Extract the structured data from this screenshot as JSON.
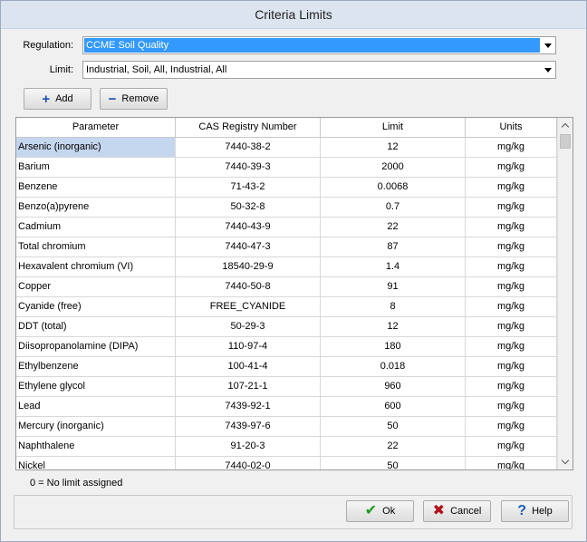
{
  "window": {
    "title": "Criteria Limits"
  },
  "regulation": {
    "label": "Regulation:",
    "value": "CCME Soil Quality"
  },
  "limit": {
    "label": "Limit:",
    "value": "Industrial, Soil, All, Industrial, All"
  },
  "toolbar": {
    "add_label": "Add",
    "remove_label": "Remove"
  },
  "table": {
    "columns": [
      "Parameter",
      "CAS Registry Number",
      "Limit",
      "Units"
    ],
    "rows": [
      [
        "Arsenic (inorganic)",
        "7440-38-2",
        "12",
        "mg/kg"
      ],
      [
        "Barium",
        "7440-39-3",
        "2000",
        "mg/kg"
      ],
      [
        "Benzene",
        "71-43-2",
        "0.0068",
        "mg/kg"
      ],
      [
        "Benzo(a)pyrene",
        "50-32-8",
        "0.7",
        "mg/kg"
      ],
      [
        "Cadmium",
        "7440-43-9",
        "22",
        "mg/kg"
      ],
      [
        "Total chromium",
        "7440-47-3",
        "87",
        "mg/kg"
      ],
      [
        "Hexavalent chromium (VI)",
        "18540-29-9",
        "1.4",
        "mg/kg"
      ],
      [
        "Copper",
        "7440-50-8",
        "91",
        "mg/kg"
      ],
      [
        "Cyanide (free)",
        "FREE_CYANIDE",
        "8",
        "mg/kg"
      ],
      [
        "DDT (total)",
        "50-29-3",
        "12",
        "mg/kg"
      ],
      [
        "Diisopropanolamine (DIPA)",
        "110-97-4",
        "180",
        "mg/kg"
      ],
      [
        "Ethylbenzene",
        "100-41-4",
        "0.018",
        "mg/kg"
      ],
      [
        "Ethylene glycol",
        "107-21-1",
        "960",
        "mg/kg"
      ],
      [
        "Lead",
        "7439-92-1",
        "600",
        "mg/kg"
      ],
      [
        "Mercury (inorganic)",
        "7439-97-6",
        "50",
        "mg/kg"
      ],
      [
        "Naphthalene",
        "91-20-3",
        "22",
        "mg/kg"
      ],
      [
        "Nickel",
        "7440-02-0",
        "50",
        "mg/kg"
      ]
    ]
  },
  "note": "0 = No limit assigned",
  "footer": {
    "ok_label": "Ok",
    "cancel_label": "Cancel",
    "help_label": "Help"
  },
  "colors": {
    "selection": "#3399ff",
    "current_cell": "#c5d6ef",
    "ok_check": "#1e9a1e",
    "cancel_x": "#b0101a",
    "help_q": "#1c5fb8"
  }
}
